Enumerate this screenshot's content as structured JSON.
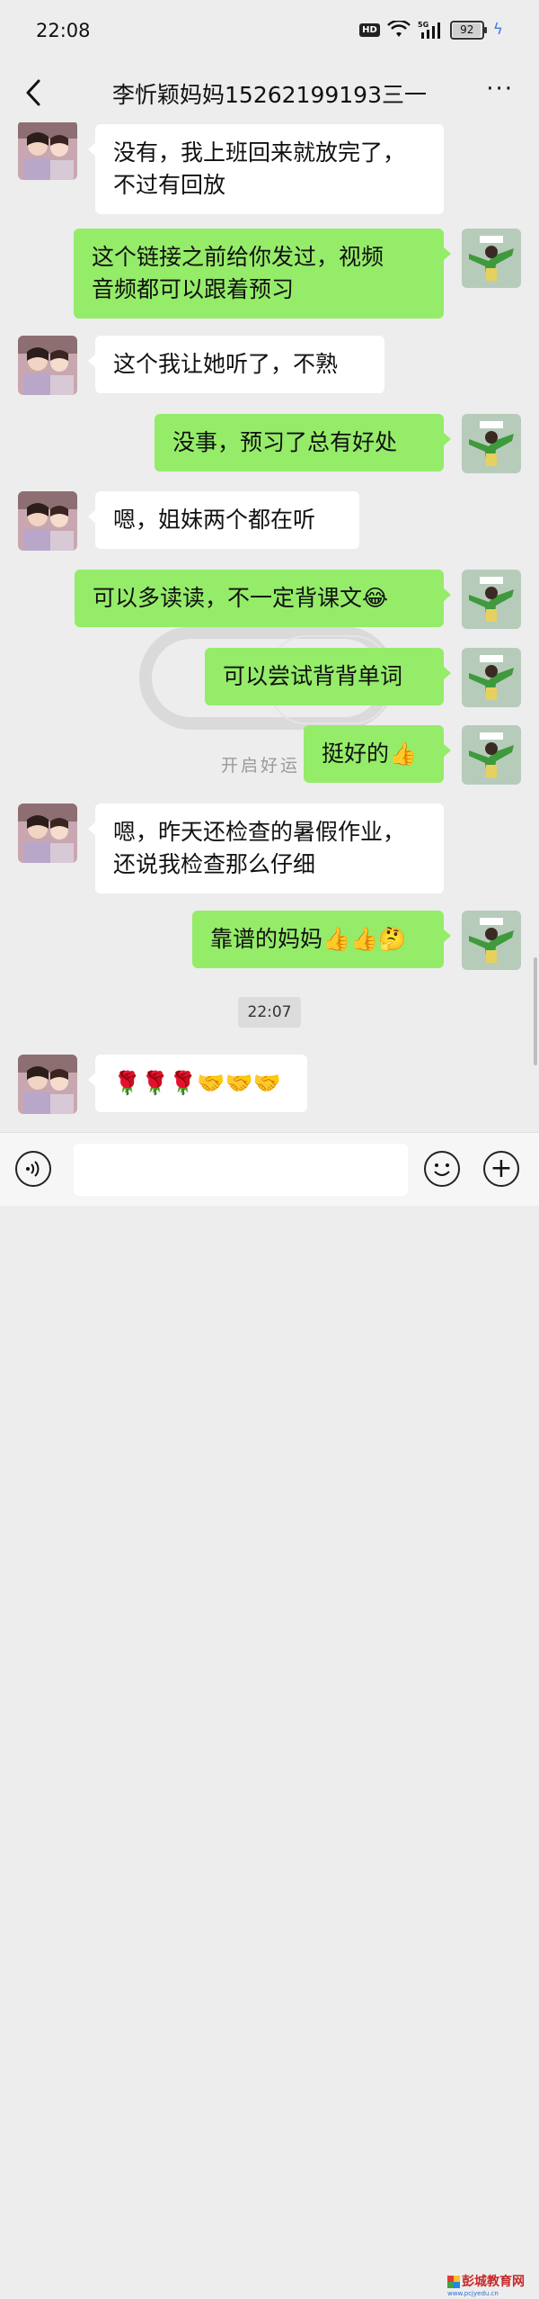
{
  "status_bar": {
    "time": "22:08",
    "hd": "HD",
    "network": "5G",
    "battery": "92",
    "battery_level": 0.92
  },
  "header": {
    "title": "李忻颖妈妈15262199193三一",
    "more": "···"
  },
  "background_prompt": "开启好运",
  "messages": [
    {
      "side": "in",
      "lines": [
        "没有，我上班回来就放完了，",
        "不过有回放"
      ]
    },
    {
      "side": "out",
      "lines": [
        "这个链接之前给你发过，视频",
        "音频都可以跟着预习"
      ]
    },
    {
      "side": "in",
      "lines": [
        "这个我让她听了，不熟"
      ]
    },
    {
      "side": "out",
      "lines": [
        "没事，预习了总有好处"
      ]
    },
    {
      "side": "in",
      "lines": [
        "嗯，姐妹两个都在听"
      ]
    },
    {
      "side": "out",
      "lines": [
        "可以多读读，不一定背课文😂"
      ]
    },
    {
      "side": "out",
      "lines": [
        "可以尝试背背单词"
      ]
    },
    {
      "side": "out",
      "lines": [
        "挺好的👍"
      ]
    },
    {
      "side": "in",
      "lines": [
        "嗯，昨天还检查的暑假作业，",
        "还说我检查那么仔细"
      ]
    },
    {
      "side": "out",
      "lines": [
        "靠谱的妈妈👍👍🤔"
      ]
    },
    {
      "side": "in",
      "lines": [
        "🌹🌹🌹🤝🤝🤝"
      ]
    }
  ],
  "timestamp": "22:07",
  "avatars": {
    "contact": "contact-avatar",
    "self": "self-avatar"
  },
  "watermark": {
    "name": "彭城教育网",
    "url": "www.pcjyedu.cn"
  },
  "colors": {
    "outgoing": "#95ec69",
    "incoming": "#ffffff",
    "background": "#ededed"
  }
}
